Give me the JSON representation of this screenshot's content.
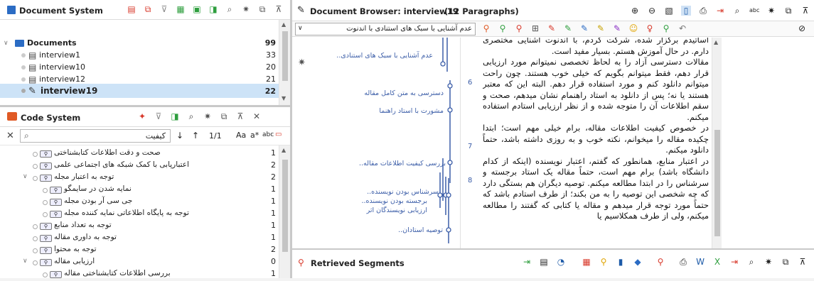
{
  "document_system": {
    "title": "Document System",
    "items": [
      {
        "label": "Documents",
        "count": "99"
      },
      {
        "label": "interview1",
        "count": "33"
      },
      {
        "label": "interview10",
        "count": "20"
      },
      {
        "label": "interview12",
        "count": "21"
      },
      {
        "label": "interview19",
        "count": "22"
      }
    ]
  },
  "code_system": {
    "title": "Code System",
    "search_value": "کیفیت",
    "match_count": "1/1",
    "case_label": "Aa",
    "regex_label": "a*",
    "word_label": "abc",
    "codes": [
      {
        "label": "صحت و دقت اطلاعات کتابشناختی",
        "count": "1"
      },
      {
        "label": "اعتبارپابی با کمک شبکه های اجتماعی علمی",
        "count": "2"
      },
      {
        "label": "توجه به اعتبار مجله",
        "count": "2"
      },
      {
        "label": "نمایه شدن در سایمگو",
        "count": "1"
      },
      {
        "label": "جی سی آر بودن مجله",
        "count": "1"
      },
      {
        "label": "توجه به پایگاه اطلاعاتی نمایه کننده مجله",
        "count": "1"
      },
      {
        "label": "توجه به تعداد منابع",
        "count": "1"
      },
      {
        "label": "توجه به داوری مقاله",
        "count": "1"
      },
      {
        "label": "توجه به محتوا",
        "count": "2"
      },
      {
        "label": "ارزیابی مقاله",
        "count": "0"
      },
      {
        "label": "بررسی اطلاعات کتابشناختی مقاله",
        "count": "1"
      }
    ]
  },
  "browser": {
    "title": "Document Browser: interview19",
    "paragraphs_label": "(12 Paragraphs)",
    "code_select": "عدم آشنایی با سبک های استنادی با اندنوت",
    "margin_labels": [
      "عدم آشنایی با سبک های استنادی..",
      "دسترسی به متن کامل مقاله",
      "مشورت با استاد راهنما",
      "بررسی کیفیت اطلاعات مقاله..",
      "سرشناس بودن نویسنده..",
      "برجسته بودن نویسنده..",
      "ارزیابی نویسندگان اثر",
      "توصیه استادان.."
    ],
    "para_numbers": [
      "6",
      "7",
      "8"
    ],
    "paragraphs": [
      "اساتیدم برگزار شده، شرکت کردم، با اندنوت آشنایی مختصری دارم. در حال آموزش هستم. بسیار مفید است.",
      "مقالات دسترسی آزاد را به لحاظ تخصصی نمیتوانم مورد ارزیابی قرار دهم، فقط میتوانم بگویم که خیلی خوب هستند. چون راحت میتوانم دانلود کنم و مورد استفاده قرار دهم. البته این که معتبر هستند یا نه؛ پس از دانلود به استاد راهنمام نشان میدهم، صحت و سقم اطلاعات آن را متوجه شده و از نظر ارزیابی استادم استفاده میکنم.",
      "در خصوص کیفیت اطلاعات مقاله، برام خیلی مهم است؛ ابتدا چکیده مقاله را میخوانم، نکته خوب و به روزی داشته باشد، حتماً دانلود میکنم.",
      "در اعتبار منابع، همانطور که گفتم، اعتبار نویسنده (اینکه از کدام دانشگاه باشد) برام مهم است، حتماً مقاله یک استاد برجسته و سرشناس را در ابتدا مطالعه میکنم. توصیه دیگران هم بستگی دارد که چه شخصی این توصیه را به من بکند؛ از طرف استادم باشد که حتماً مورد توجه قرار میدهم و مقاله یا کتابی که گفتند را مطالعه میکنم، ولی از طرف همکلاسیم یا"
    ]
  },
  "retrieved": {
    "title": "Retrieved Segments"
  },
  "colors": {
    "accent": "#1d5aa8",
    "red": "#d8392b",
    "folder": "#2b6cc4"
  }
}
